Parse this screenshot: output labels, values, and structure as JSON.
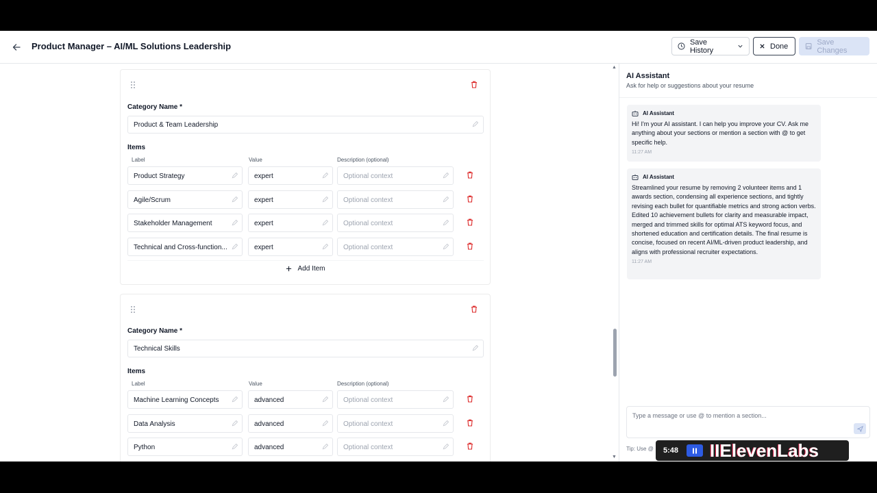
{
  "header": {
    "title": "Product Manager – AI/ML Solutions Leadership",
    "save_history_label": "Save History",
    "done_label": "Done",
    "save_changes_label": "Save Changes"
  },
  "editor": {
    "categories": [
      {
        "name_label": "Category Name *",
        "name_value": "Product & Team Leadership",
        "items_label": "Items",
        "col_label": "Label",
        "col_value": "Value",
        "col_desc": "Description (optional)",
        "items": [
          {
            "label": "Product Strategy",
            "value": "expert",
            "desc_placeholder": "Optional context"
          },
          {
            "label": "Agile/Scrum",
            "value": "expert",
            "desc_placeholder": "Optional context"
          },
          {
            "label": "Stakeholder Management",
            "value": "expert",
            "desc_placeholder": "Optional context"
          },
          {
            "label": "Technical and Cross-function...",
            "value": "expert",
            "desc_placeholder": "Optional context"
          }
        ],
        "add_item_label": "Add Item"
      },
      {
        "name_label": "Category Name *",
        "name_value": "Technical Skills",
        "items_label": "Items",
        "col_label": "Label",
        "col_value": "Value",
        "col_desc": "Description (optional)",
        "items": [
          {
            "label": "Machine Learning Concepts",
            "value": "advanced",
            "desc_placeholder": "Optional context"
          },
          {
            "label": "Data Analysis",
            "value": "advanced",
            "desc_placeholder": "Optional context"
          },
          {
            "label": "Python",
            "value": "advanced",
            "desc_placeholder": "Optional context"
          }
        ]
      }
    ]
  },
  "ai_panel": {
    "title": "AI Assistant",
    "subtitle": "Ask for help or suggestions about your resume",
    "messages": [
      {
        "sender": "AI Assistant",
        "text": "Hi! I'm your AI assistant. I can help you improve your CV. Ask me anything about your sections or mention a section with @ to get specific help.",
        "time": "11:27 AM"
      },
      {
        "sender": "AI Assistant",
        "text": "Streamlined your resume by removing 2 volunteer items and 1 awards section, condensing all experience sections, and tightly revising each bullet for quantifiable metrics and strong action verbs. Edited 10 achievement bullets for clarity and measurable impact, merged and trimmed skills for optimal ATS keyword focus, and shortened education and certification details. The final resume is concise, focused on recent AI/ML-driven product leadership, and aligns with professional recruiter expectations.",
        "time": "11:27 AM"
      }
    ],
    "input_placeholder": "Type a message or use @ to mention a section...",
    "tip": "Tip: Use @"
  },
  "recorder": {
    "time": "5:48",
    "brand": "IIElevenLabs"
  },
  "colors": {
    "danger": "#dc2626",
    "save_disabled_bg": "#dbe4f6",
    "message_bg": "#f3f4f6"
  }
}
